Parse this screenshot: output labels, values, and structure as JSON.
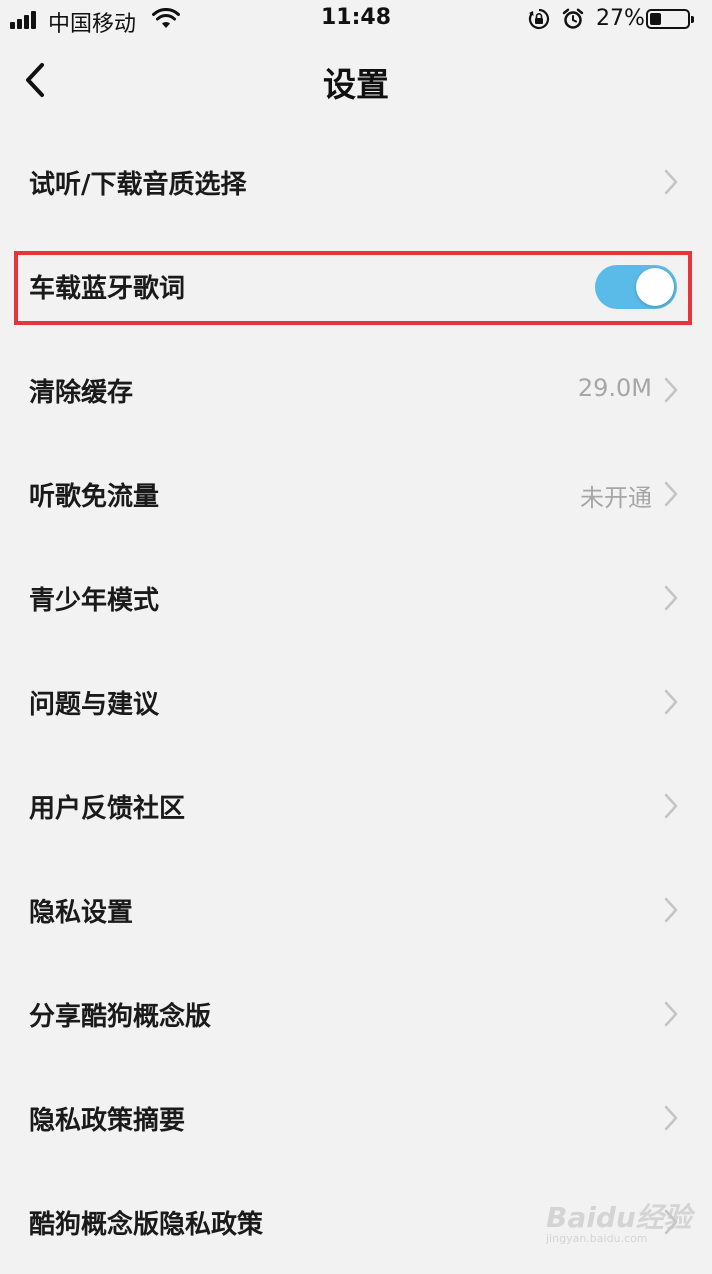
{
  "status_bar": {
    "carrier": "中国移动",
    "time": "11:48",
    "battery_percent": "27%",
    "battery_level": 0.27
  },
  "nav": {
    "title": "设置",
    "back_icon": "chevron-left-icon"
  },
  "settings": [
    {
      "label": "试听/下载音质选择",
      "value": "",
      "control": "chevron"
    },
    {
      "label": "车载蓝牙歌词",
      "value": "",
      "control": "toggle",
      "toggle_on": true
    },
    {
      "label": "清除缓存",
      "value": "29.0M",
      "control": "chevron"
    },
    {
      "label": "听歌免流量",
      "value": "未开通",
      "control": "chevron"
    },
    {
      "label": "青少年模式",
      "value": "",
      "control": "chevron"
    },
    {
      "label": "问题与建议",
      "value": "",
      "control": "chevron"
    },
    {
      "label": "用户反馈社区",
      "value": "",
      "control": "chevron"
    },
    {
      "label": "隐私设置",
      "value": "",
      "control": "chevron"
    },
    {
      "label": "分享酷狗概念版",
      "value": "",
      "control": "chevron"
    },
    {
      "label": "隐私政策摘要",
      "value": "",
      "control": "chevron"
    },
    {
      "label": "酷狗概念版隐私政策",
      "value": "",
      "control": "chevron"
    }
  ],
  "colors": {
    "background": "#f2f2f2",
    "toggle_on": "#5bbbe8",
    "highlight_border": "#e8343b",
    "secondary_text": "#a6a6a6"
  },
  "watermark": {
    "logo_text": "Baidu经验",
    "sub_text": "jingyan.baidu.com"
  }
}
